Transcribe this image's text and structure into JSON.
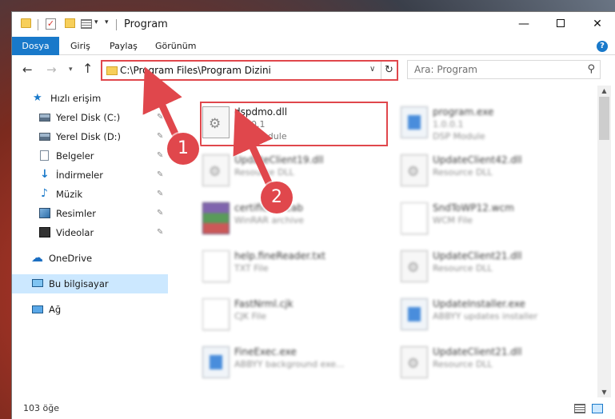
{
  "window": {
    "title": "Program",
    "quick_access_dropdown": "▾"
  },
  "ribbon": {
    "tabs": [
      "Dosya",
      "Giriş",
      "Paylaş",
      "Görünüm"
    ],
    "help": "?"
  },
  "nav": {
    "address": "C:\\Program Files\\Program Dizini",
    "search_placeholder": "Ara: Program"
  },
  "sidebar": {
    "items": [
      {
        "label": "Hızlı erişim",
        "icon": "star-icon",
        "pinned": false
      },
      {
        "label": "Yerel Disk (C:)",
        "icon": "drive-icon",
        "pinned": true
      },
      {
        "label": "Yerel Disk (D:)",
        "icon": "drive-icon",
        "pinned": true
      },
      {
        "label": "Belgeler",
        "icon": "document-icon",
        "pinned": true
      },
      {
        "label": "İndirmeler",
        "icon": "download-icon",
        "pinned": true
      },
      {
        "label": "Müzik",
        "icon": "music-icon",
        "pinned": true
      },
      {
        "label": "Resimler",
        "icon": "pictures-icon",
        "pinned": true
      },
      {
        "label": "Videolar",
        "icon": "video-icon",
        "pinned": true
      },
      {
        "label": "OneDrive",
        "icon": "cloud-icon",
        "pinned": false
      },
      {
        "label": "Bu bilgisayar",
        "icon": "computer-icon",
        "pinned": false,
        "selected": true
      },
      {
        "label": "Ağ",
        "icon": "network-icon",
        "pinned": false
      }
    ],
    "pin_glyph": "📌"
  },
  "files": [
    {
      "name": "dspdmo.dll",
      "line1": "1.0.0.1",
      "line2": "DSP Module",
      "icon": "dll-icon",
      "highlighted": true
    },
    {
      "name": "program.exe",
      "line1": "1.0.0.1",
      "line2": "DSP Module",
      "icon": "exe-icon"
    },
    {
      "name": "UpdateClient19.dll",
      "line1": "Resource DLL",
      "line2": "",
      "icon": "dll-icon"
    },
    {
      "name": "UpdateClient42.dll",
      "line1": "Resource DLL",
      "line2": "",
      "icon": "dll-icon"
    },
    {
      "name": "certificate.cab",
      "line1": "WinRAR archive",
      "line2": "",
      "icon": "archive-icon"
    },
    {
      "name": "SndToWP12.wcm",
      "line1": "WCM File",
      "line2": "",
      "icon": "document-icon"
    },
    {
      "name": "help.fineReader.txt",
      "line1": "TXT File",
      "line2": "",
      "icon": "document-icon"
    },
    {
      "name": "UpdateClient21.dll",
      "line1": "Resource DLL",
      "line2": "",
      "icon": "dll-icon"
    },
    {
      "name": "FastNrml.cjk",
      "line1": "CJK File",
      "line2": "",
      "icon": "document-icon"
    },
    {
      "name": "UpdateInstaller.exe",
      "line1": "ABBYY updates installer",
      "line2": "",
      "icon": "exe-icon"
    },
    {
      "name": "FineExec.exe",
      "line1": "ABBYY background exe...",
      "line2": "",
      "icon": "exe-icon"
    },
    {
      "name": "UpdateClient21.dll",
      "line1": "Resource DLL",
      "line2": "",
      "icon": "dll-icon"
    }
  ],
  "status": {
    "count": "103 öğe"
  },
  "annotations": {
    "badge_1": "1",
    "badge_2": "2",
    "color": "#e0474c"
  },
  "colors": {
    "accent": "#1979ca",
    "selection": "#cce8ff"
  }
}
